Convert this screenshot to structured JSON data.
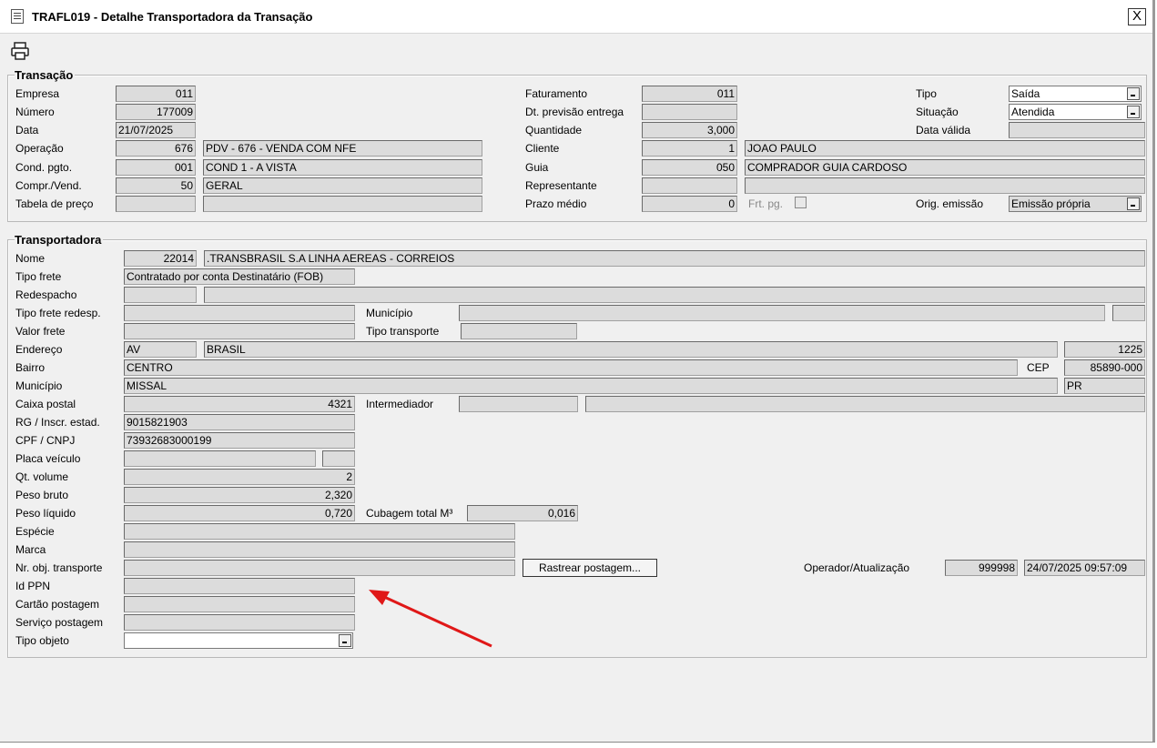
{
  "window": {
    "title": "TRAFL019 - Detalhe Transportadora da Transação",
    "close_label": "X"
  },
  "toolbar": {
    "print_icon": "printer-icon"
  },
  "transacao": {
    "legend": "Transação",
    "empresa_label": "Empresa",
    "empresa": "011",
    "numero_label": "Número",
    "numero": "177009",
    "data_label": "Data",
    "data": "21/07/2025",
    "operacao_label": "Operação",
    "operacao_code": "676",
    "operacao_desc": "PDV - 676 - VENDA COM NFE",
    "cond_label": "Cond. pgto.",
    "cond_code": "001",
    "cond_desc": "COND 1 - A VISTA",
    "compr_label": "Compr./Vend.",
    "compr_code": "50",
    "compr_desc": "GERAL",
    "tabela_label": "Tabela de preço",
    "tabela_code": "",
    "tabela_desc": "",
    "faturamento_label": "Faturamento",
    "faturamento": "011",
    "dtprev_label": "Dt. previsão entrega",
    "dtprev": "",
    "quantidade_label": "Quantidade",
    "quantidade": "3,000",
    "cliente_label": "Cliente",
    "cliente_code": "1",
    "cliente_name": "JOAO PAULO",
    "guia_label": "Guia",
    "guia_code": "050",
    "guia_name": "COMPRADOR GUIA CARDOSO",
    "representante_label": "Representante",
    "representante_code": "",
    "representante_name": "",
    "prazo_label": "Prazo médio",
    "prazo": "0",
    "frtpg_label": "Frt. pg.",
    "tipo_label": "Tipo",
    "tipo": "Saída",
    "situacao_label": "Situação",
    "situacao": "Atendida",
    "datavalida_label": "Data válida",
    "datavalida": "",
    "origem_label": "Orig. emissão",
    "origem": "Emissão própria"
  },
  "transportadora": {
    "legend": "Transportadora",
    "nome_label": "Nome",
    "nome_code": "22014",
    "nome": ".TRANSBRASIL S.A LINHA AEREAS - CORREIOS",
    "tipofrete_label": "Tipo frete",
    "tipofrete": "Contratado por conta Destinatário (FOB)",
    "redespacho_label": "Redespacho",
    "redespacho_code": "",
    "redespacho_name": "",
    "tipofreteredesp_label": "Tipo frete redesp.",
    "tipofreteredesp": "",
    "municipio_redesp_label": "Município",
    "municipio_redesp": "",
    "municipio_redesp_uf": "",
    "valorfrete_label": "Valor frete",
    "valorfrete": "",
    "tipotransporte_label": "Tipo transporte",
    "tipotransporte": "",
    "endereco_label": "Endereço",
    "endereco_tipo": "AV",
    "endereco": "BRASIL",
    "endereco_num": "1225",
    "bairro_label": "Bairro",
    "bairro": "CENTRO",
    "cep_label": "CEP",
    "cep": "85890-000",
    "municipio_label": "Município",
    "municipio": "MISSAL",
    "uf": "PR",
    "caixapostal_label": "Caixa postal",
    "caixapostal": "4321",
    "intermediador_label": "Intermediador",
    "intermediador_code": "",
    "intermediador_name": "",
    "rg_label": "RG / Inscr. estad.",
    "rg": "9015821903",
    "cpf_label": "CPF / CNPJ",
    "cpf": "73932683000199",
    "placa_label": "Placa veículo",
    "placa": "",
    "placa_uf": "",
    "qtvolume_label": "Qt. volume",
    "qtvolume": "2",
    "pesobruto_label": "Peso bruto",
    "pesobruto": "2,320",
    "pesoliq_label": "Peso líquido",
    "pesoliq": "0,720",
    "cubagem_label": "Cubagem total M³",
    "cubagem": "0,016",
    "especie_label": "Espécie",
    "especie": "",
    "marca_label": "Marca",
    "marca": "",
    "nrobj_label": "Nr. obj. transporte",
    "nrobj": "",
    "rastrear_label": "Rastrear postagem...",
    "operador_label": "Operador/Atualização",
    "operador": "999998",
    "atualizacao": "24/07/2025 09:57:09",
    "idppn_label": "Id PPN",
    "idppn": "",
    "cartao_label": "Cartão postagem",
    "cartao": "",
    "servico_label": "Serviço postagem",
    "servico": "",
    "tipoobj_label": "Tipo objeto",
    "tipoobj": ""
  },
  "annotation": {
    "arrow_color": "#e01818"
  }
}
